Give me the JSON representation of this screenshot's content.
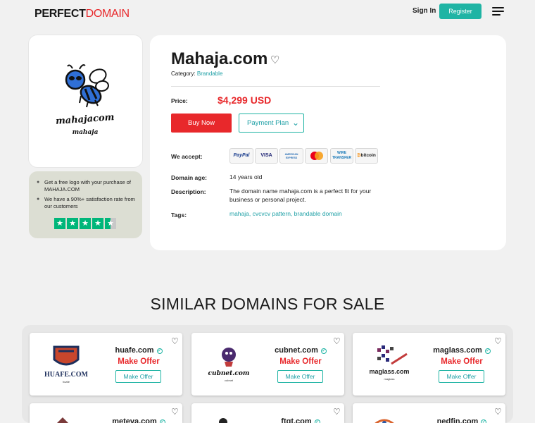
{
  "header": {
    "logo_part1": "PERFECT",
    "logo_part2": "DOMAIN",
    "signin_label": "Sign In",
    "register_label": "Register",
    "menu_icon": "hamburger-icon"
  },
  "logo_card": {
    "logo_text_1": "mahajacom",
    "logo_text_2": "mahaja"
  },
  "promo": {
    "items": [
      "Get a free logo with your purchase of MAHAJA.COM",
      "We have a 90%+ satisfaction rate from our customers"
    ],
    "rating_stars": 4.5
  },
  "domain": {
    "title": "Mahaja.com",
    "category_label": "Category:",
    "category_value": "Brandable",
    "price_label": "Price:",
    "price": "$4,299 USD",
    "buy_label": "Buy Now",
    "plan_label": "Payment Plan",
    "accept_label": "We accept:",
    "payment_methods": [
      "PayPal",
      "VISA",
      "AMERICAN EXPRESS",
      "mastercard",
      "WIRE TRANSFER",
      "bitcoin"
    ],
    "age_label": "Domain age:",
    "age_value": "14 years old",
    "desc_label": "Description:",
    "desc_value": "The domain name mahaja.com is a perfect fit for your business or personal project.",
    "tags_label": "Tags:",
    "tags_value": "mahaja, cvcvcv pattern, brandable domain"
  },
  "similar": {
    "title": "SIMILAR DOMAINS FOR SALE",
    "make_offer_label": "Make Offer",
    "items": [
      {
        "name": "huafe.com",
        "logo_text": "HUAFE.COM",
        "logo_sub": "huafe"
      },
      {
        "name": "cubnet.com",
        "logo_text": "cubnet.com",
        "logo_sub": "cubnet"
      },
      {
        "name": "maglass.com",
        "logo_text": "maglass.com",
        "logo_sub": "maglass"
      },
      {
        "name": "meteva.com",
        "logo_text": "",
        "logo_sub": ""
      },
      {
        "name": "ftqt.com",
        "logo_text": "",
        "logo_sub": ""
      },
      {
        "name": "nedfin.com",
        "logo_text": "",
        "logo_sub": ""
      }
    ]
  },
  "colors": {
    "accent_teal": "#1fb4a4",
    "accent_red": "#e8282b",
    "trustpilot_green": "#00b67a"
  }
}
